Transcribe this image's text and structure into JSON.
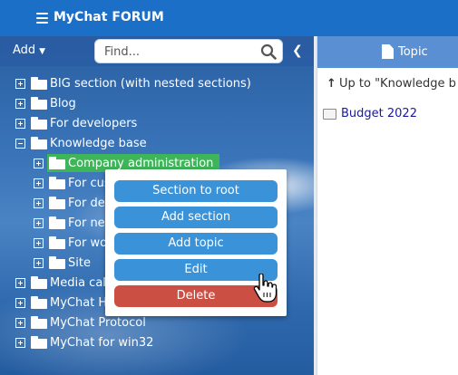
{
  "app": {
    "title": "MyChat FORUM"
  },
  "left_toolbar": {
    "add_label": "Add",
    "search_placeholder": "Find..."
  },
  "tree": {
    "items": [
      {
        "label": "BIG section (with nested sections)",
        "expander": "plus",
        "level": 0
      },
      {
        "label": "Blog",
        "expander": "plus",
        "level": 0
      },
      {
        "label": "For developers",
        "expander": "plus",
        "level": 0
      },
      {
        "label": "Knowledge base",
        "expander": "minus",
        "level": 0
      },
      {
        "label": "Company administration",
        "expander": "plus",
        "level": 1,
        "selected": true
      },
      {
        "label": "For cus",
        "expander": "plus",
        "level": 1
      },
      {
        "label": "For de",
        "expander": "plus",
        "level": 1
      },
      {
        "label": "For ne",
        "expander": "plus",
        "level": 1
      },
      {
        "label": "For wo",
        "expander": "plus",
        "level": 1
      },
      {
        "label": "Site",
        "expander": "plus",
        "level": 1
      },
      {
        "label": "Media call",
        "expander": "plus",
        "level": 0
      },
      {
        "label": "MyChat Ho",
        "expander": "plus",
        "level": 0
      },
      {
        "label": "MyChat Protocol",
        "expander": "plus",
        "level": 0
      },
      {
        "label": "MyChat for win32",
        "expander": "plus",
        "level": 0
      }
    ]
  },
  "context_menu": {
    "items": [
      {
        "label": "Section to root"
      },
      {
        "label": "Add section"
      },
      {
        "label": "Add topic"
      },
      {
        "label": "Edit"
      },
      {
        "label": "Delete"
      }
    ]
  },
  "right_panel": {
    "header_label": "Topic",
    "up_link": "Up to \"Knowledge b",
    "topics": [
      {
        "label": "Budget 2022"
      }
    ]
  },
  "colors": {
    "topbar": "#1c6fc7",
    "selected": "#3fb55a",
    "menu_button": "#3a92d8",
    "delete_button": "#cc4f44",
    "right_header": "#5b8fd3"
  }
}
